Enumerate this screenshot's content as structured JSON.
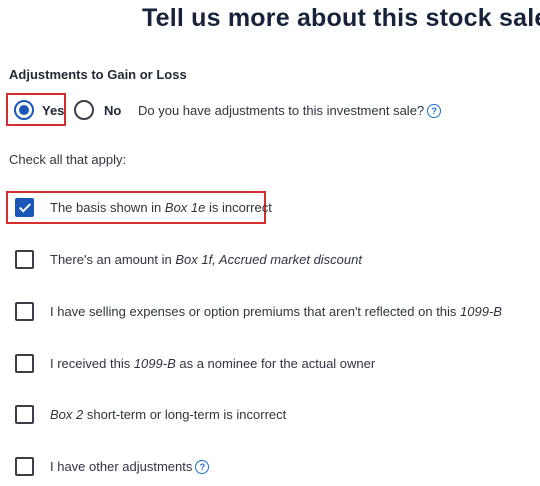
{
  "page_title": "Tell us more about this stock sale",
  "adjustments": {
    "section_label": "Adjustments to Gain or Loss",
    "yes_label": "Yes",
    "no_label": "No",
    "selected": "Yes",
    "question": "Do you have adjustments to this investment sale?",
    "help_glyph": "?"
  },
  "check_all_label": "Check all that apply:",
  "options": [
    {
      "checked": true,
      "parts": [
        "The basis shown in ",
        "Box 1e",
        " is incorrect"
      ]
    },
    {
      "checked": false,
      "parts": [
        "There's an amount in ",
        "Box 1f, Accrued market discount",
        ""
      ]
    },
    {
      "checked": false,
      "parts": [
        "I have selling expenses or option premiums that aren't reflected on this ",
        "1099-B",
        ""
      ]
    },
    {
      "checked": false,
      "parts": [
        "I received this ",
        "1099-B",
        " as a nominee for the actual owner"
      ]
    },
    {
      "checked": false,
      "parts": [
        "",
        "Box 2",
        " short-term or long-term is incorrect"
      ]
    },
    {
      "checked": false,
      "parts": [
        "I have other adjustments",
        "",
        ""
      ],
      "has_help": true
    }
  ],
  "colors": {
    "accent": "#1a56b8",
    "highlight_border": "#d32f2f",
    "help_icon": "#1a6fd1",
    "title": "#17233a"
  }
}
